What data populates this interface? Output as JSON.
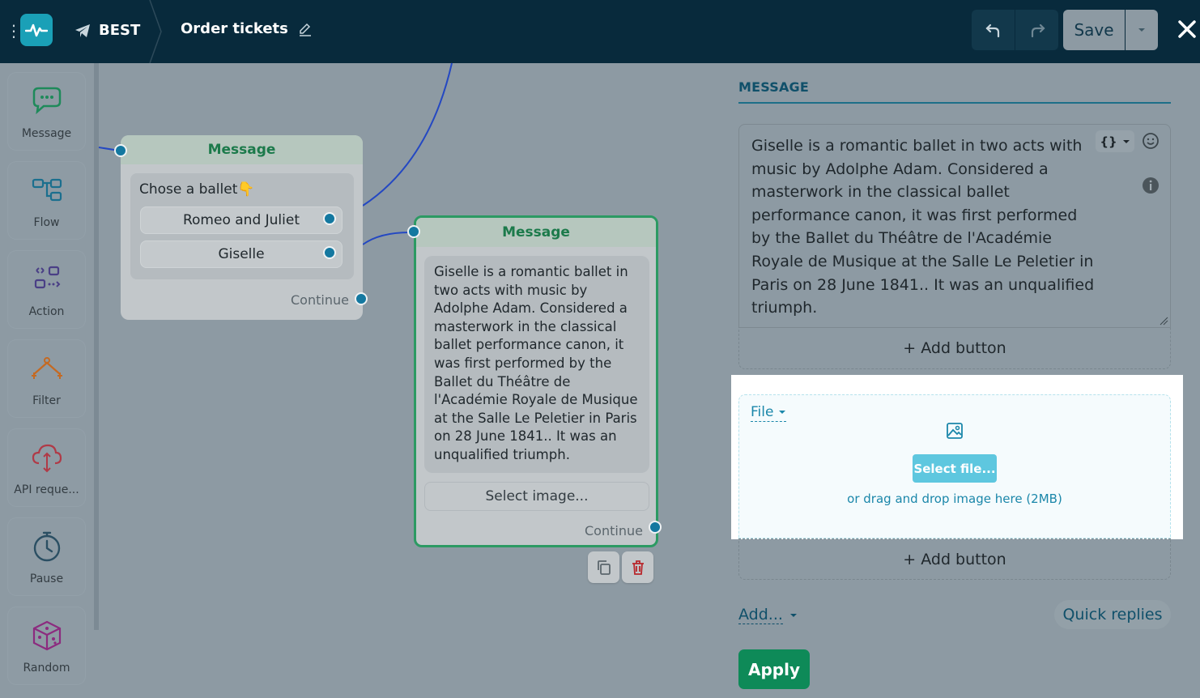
{
  "header": {
    "bot_name": "BEST",
    "flow_title": "Order tickets",
    "save_label": "Save"
  },
  "sidebar": {
    "items": [
      {
        "label": "Message",
        "icon": "message-bubble-icon"
      },
      {
        "label": "Flow",
        "icon": "flow-icon"
      },
      {
        "label": "Action",
        "icon": "action-icon"
      },
      {
        "label": "Filter",
        "icon": "filter-icon"
      },
      {
        "label": "API reque...",
        "icon": "api-cloud-icon"
      },
      {
        "label": "Pause",
        "icon": "clock-icon"
      },
      {
        "label": "Random",
        "icon": "dice-icon"
      }
    ]
  },
  "canvas": {
    "node1": {
      "title": "Message",
      "question": "Chose a ballet👇",
      "choices": [
        "Romeo and Juliet",
        "Giselle"
      ],
      "continue_label": "Continue"
    },
    "node2": {
      "title": "Message",
      "text": "Giselle is a romantic ballet in two acts with music by Adolphe Adam. Considered a masterwork in the classical ballet performance canon, it was first performed by the Ballet du Théâtre de l'Académie Royale de Musique at the Salle Le Peletier in Paris on 28 June 1841.. It was an unqualified triumph.",
      "select_image_label": "Select image...",
      "continue_label": "Continue"
    }
  },
  "panel": {
    "section_title": "MESSAGE",
    "message_text": "Giselle is a romantic ballet in two acts with music by Adolphe Adam. Considered a masterwork in the classical ballet performance canon, it was first performed by the Ballet du Théâtre de l'Académie Royale de Musique at the Salle Le Peletier in Paris on 28 June 1841.. It was an unqualified triumph.",
    "add_button_label": "+ Add button",
    "file_dropdown_label": "File",
    "select_file_label": "Select file...",
    "drag_text": "or drag and drop image here (2MB)",
    "add_button_label_2": "+ Add button",
    "add_dropdown_label": "Add...",
    "quick_replies_label": "Quick replies",
    "apply_label": "Apply"
  },
  "colors": {
    "topbar": "#082a3c",
    "accent_teal": "#1aa0b7",
    "node_green": "#2c9a63",
    "apply_green": "#0e8a58",
    "link_blue": "#1b87aa"
  }
}
